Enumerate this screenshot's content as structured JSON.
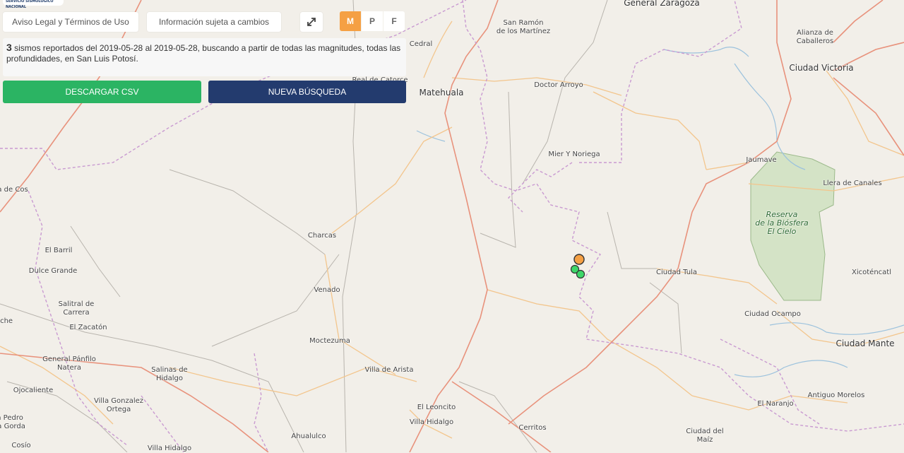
{
  "header": {
    "logo_text": "SERVICIO SISMOLÓGICO NACIONAL",
    "legal_button": "Aviso Legal y Términos de Uso",
    "info_button": "Información sujeta a cambios",
    "expand_icon": "expand-arrows-icon",
    "segments": [
      "M",
      "P",
      "F"
    ],
    "active_segment": "M"
  },
  "summary": {
    "count": "3",
    "text": " sismos reportados del 2019-05-28 al 2019-05-28, buscando a partir de todas las magnitudes, todas las profundidades, en San Luis Potosí."
  },
  "actions": {
    "download_csv": "DESCARGAR CSV",
    "new_search": "NUEVA BÚSQUEDA"
  },
  "colors": {
    "download_bg": "#2bb463",
    "search_bg": "#233b6e",
    "active_segment": "#f5a044",
    "marker_orange": "#f5a044",
    "marker_green": "#3ed66a",
    "park": "#d4e3c6"
  },
  "map": {
    "labels": [
      "General Zaragoza",
      "San Ramón\nde los Martínez",
      "Alianza de\nCaballeros",
      "Ciudad Victoria",
      "Cedral",
      "Real de Catorce",
      "Matehuala",
      "Doctor Arroyo",
      "Mier Y Noriega",
      "Jaumave",
      "Llera de Canales",
      "a de Cos",
      "Charcas",
      "El Barril",
      "Dulce Grande",
      "Ciudad Tula",
      "Xicoténcatl",
      "Venado",
      "Salitral de\nCarrera",
      "El Zacatón",
      "eche",
      "Ciudad Ocampo",
      "Ciudad Mante",
      "Moctezuma",
      "General Pánfilo\nNatera",
      "Salinas de\nHidalgo",
      "Villa de Arista",
      "Ojocaliente",
      "Villa Gonzalez\nOrtega",
      "Antiguo Morelos",
      "El Naranjo",
      "El Leoncito",
      "Villa Hidalgo",
      "Cerritos",
      "Ciudad del\nMaíz",
      "n Pedro\nra Gorda",
      "Ahualulco",
      "Cosío",
      "Villa Hidalgo"
    ],
    "park_label": "Reserva\nde la Biósfera\nEl Cielo",
    "markers": [
      {
        "color": "orange",
        "type": "earthquake"
      },
      {
        "color": "green",
        "type": "earthquake"
      },
      {
        "color": "green",
        "type": "earthquake"
      }
    ]
  }
}
